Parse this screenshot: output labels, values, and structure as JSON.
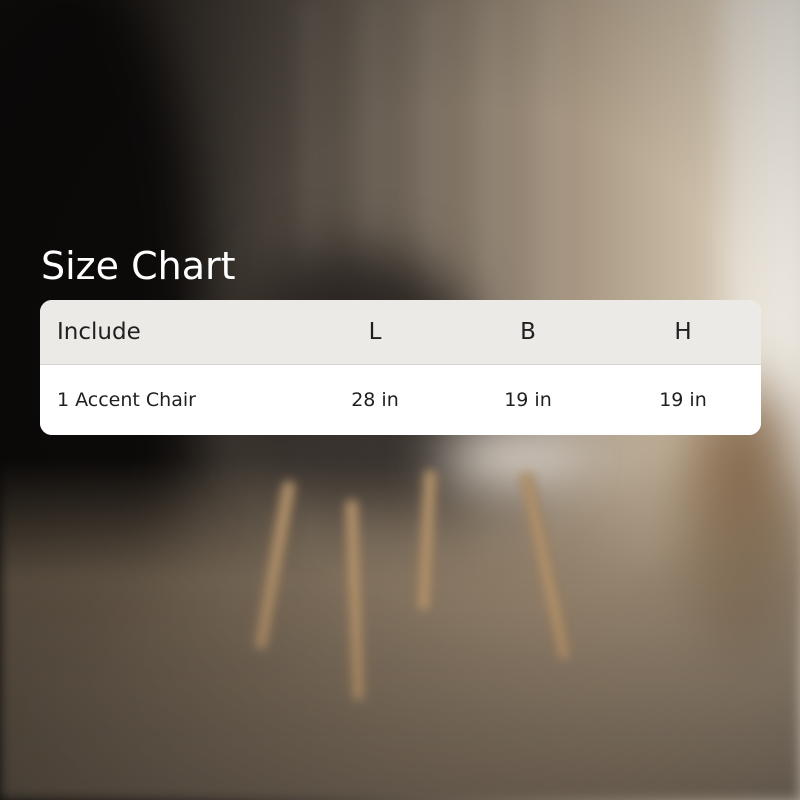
{
  "title": "Size Chart",
  "table": {
    "headers": [
      "Include",
      "L",
      "B",
      "H"
    ],
    "rows": [
      [
        "1 Accent Chair",
        "28 in",
        "19 in",
        "19 in"
      ]
    ]
  }
}
